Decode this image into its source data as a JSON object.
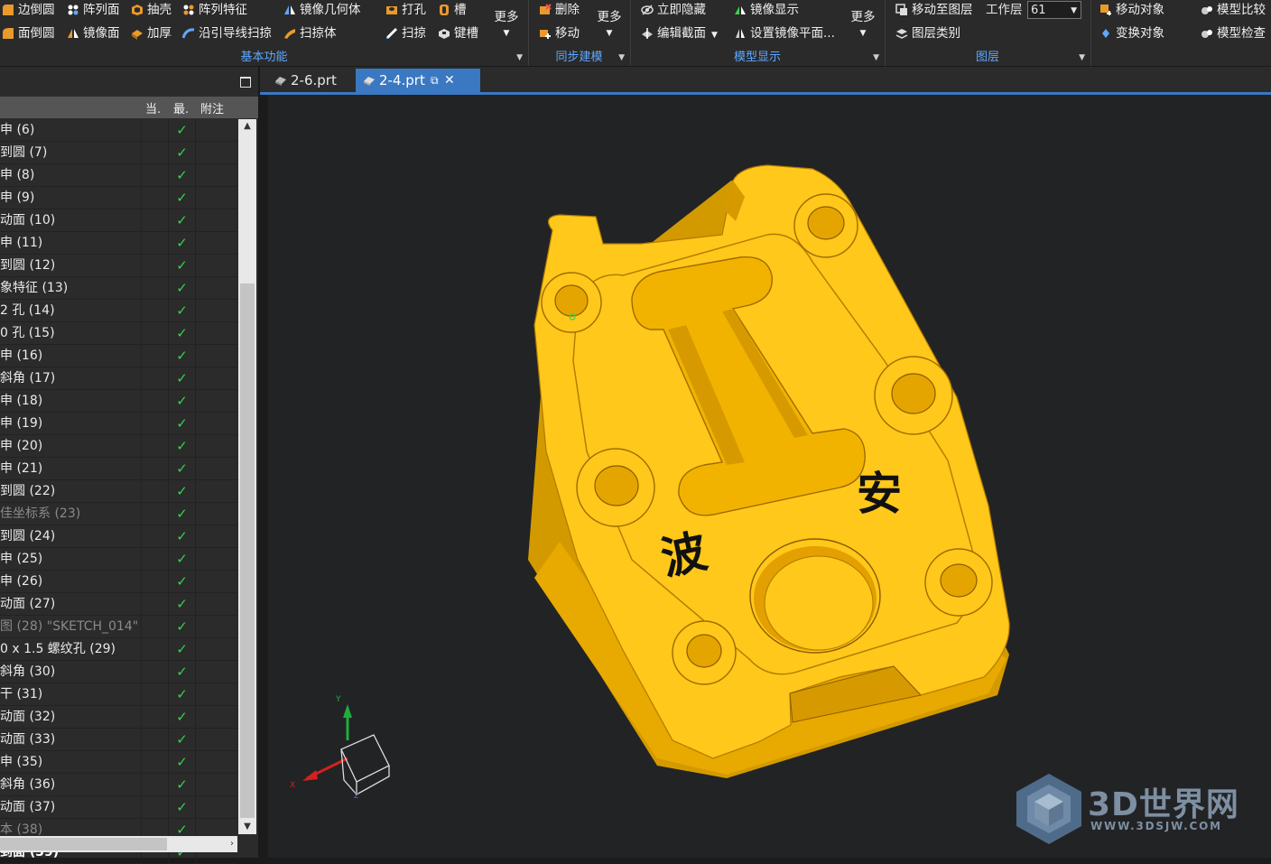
{
  "ribbon": {
    "basic": {
      "items": [
        {
          "label": "边倒圆",
          "icon": "edge-blend-icon"
        },
        {
          "label": "阵列面",
          "icon": "pattern-face-icon"
        },
        {
          "label": "抽壳",
          "icon": "shell-icon"
        },
        {
          "label": "阵列特征",
          "icon": "pattern-feature-icon"
        },
        {
          "label": "镜像几何体",
          "icon": "mirror-geometry-icon"
        },
        {
          "label": "打孔",
          "icon": "hole-icon"
        },
        {
          "label": "槽",
          "icon": "slot-icon"
        },
        {
          "label": "面倒圆",
          "icon": "face-blend-icon"
        },
        {
          "label": "镜像面",
          "icon": "mirror-face-icon"
        },
        {
          "label": "加厚",
          "icon": "thicken-icon"
        },
        {
          "label": "沿引导线扫掠",
          "icon": "sweep-guide-icon"
        },
        {
          "label": "扫掠体",
          "icon": "swept-volume-icon"
        },
        {
          "label": "扫掠",
          "icon": "sweep-icon"
        },
        {
          "label": "键槽",
          "icon": "keyway-icon"
        }
      ],
      "more": "更多",
      "label": "基本功能"
    },
    "sync": {
      "items": [
        {
          "label": "删除"
        },
        {
          "label": "移动"
        }
      ],
      "more": "更多",
      "label": "同步建模"
    },
    "display": {
      "items": [
        {
          "label": "立即隐藏"
        },
        {
          "label": "镜像显示"
        },
        {
          "label": "编辑截面"
        },
        {
          "label": "设置镜像平面..."
        }
      ],
      "more": "更多",
      "label": "模型显示"
    },
    "layer": {
      "items": [
        {
          "label": "移动至图层"
        },
        {
          "label": "图层类别"
        }
      ],
      "work_layer_label": "工作层",
      "work_layer_value": "61",
      "label": "图层"
    },
    "misc": {
      "items": [
        {
          "label": "移动对象"
        },
        {
          "label": "变换对象"
        },
        {
          "label": "模型比较"
        },
        {
          "label": "模型检查"
        }
      ]
    }
  },
  "tree": {
    "columns": [
      "当.",
      "最.",
      "附注"
    ],
    "rows": [
      {
        "name": "申 (6)"
      },
      {
        "name": "到圆 (7)"
      },
      {
        "name": "申 (8)"
      },
      {
        "name": "申 (9)"
      },
      {
        "name": "动面 (10)"
      },
      {
        "name": "申 (11)"
      },
      {
        "name": "到圆 (12)"
      },
      {
        "name": "象特征 (13)"
      },
      {
        "name": "2 孔 (14)"
      },
      {
        "name": "0 孔 (15)"
      },
      {
        "name": "申 (16)"
      },
      {
        "name": "斜角 (17)"
      },
      {
        "name": "申 (18)"
      },
      {
        "name": "申 (19)"
      },
      {
        "name": "申 (20)"
      },
      {
        "name": "申 (21)"
      },
      {
        "name": "到圆 (22)"
      },
      {
        "name": "佳坐标系 (23)",
        "dim": true
      },
      {
        "name": "到圆 (24)"
      },
      {
        "name": "申 (25)"
      },
      {
        "name": "申 (26)"
      },
      {
        "name": "动面 (27)"
      },
      {
        "name": "图 (28) \"SKETCH_014\"",
        "dim": true
      },
      {
        "name": "0 x 1.5 螺纹孔 (29)"
      },
      {
        "name": "斜角 (30)"
      },
      {
        "name": "干 (31)"
      },
      {
        "name": "动面 (32)"
      },
      {
        "name": "动面 (33)"
      },
      {
        "name": "申 (35)"
      },
      {
        "name": "斜角 (36)"
      },
      {
        "name": "动面 (37)"
      },
      {
        "name": "本 (38)",
        "dim": true
      },
      {
        "name": "到面 (39)",
        "bold": true
      }
    ],
    "check_mark": "✓"
  },
  "tabs": [
    {
      "label": "2-6.prt",
      "active": false
    },
    {
      "label": "2-4.prt",
      "active": true
    }
  ],
  "viewport": {
    "engraving": [
      "安",
      "波"
    ],
    "axis_labels": {
      "x": "X",
      "y": "Y",
      "z": "Z"
    },
    "part_color": "#ffc81a"
  },
  "watermark": {
    "brand": "3D世界网",
    "url": "WWW.3DSJW.COM"
  }
}
